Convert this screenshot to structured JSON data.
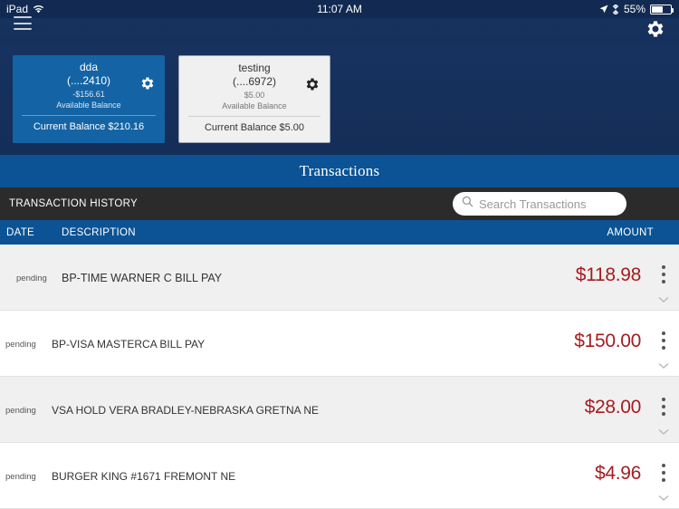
{
  "statusbar": {
    "device": "iPad",
    "wifi_icon": "wifi-icon",
    "time": "11:07 AM",
    "location_icon": "location-arrow-icon",
    "bluetooth_icon": "bluetooth-icon",
    "battery_percent": "55%",
    "battery_icon": "battery-icon"
  },
  "header": {
    "menu_icon": "hamburger-menu-icon",
    "settings_icon": "gear-icon"
  },
  "accounts": [
    {
      "name": "dda",
      "mask": "(....2410)",
      "available_amount": "-$156.61",
      "available_label": "Available Balance",
      "current_balance": "Current Balance $210.16",
      "settings_icon": "gear-icon",
      "selected": true
    },
    {
      "name": "testing",
      "mask": "(....6972)",
      "available_amount": "$5.00",
      "available_label": "Available Balance",
      "current_balance": "Current Balance $5.00",
      "settings_icon": "gear-icon",
      "selected": false
    }
  ],
  "section": {
    "title": "Transactions",
    "history_label": "TRANSACTION HISTORY"
  },
  "search": {
    "placeholder": "Search Transactions",
    "value": "",
    "icon": "search-icon"
  },
  "table": {
    "columns": {
      "date": "DATE",
      "description": "DESCRIPTION",
      "amount": "AMOUNT"
    },
    "rows": [
      {
        "date": "pending",
        "description": "BP-TIME WARNER C BILL PAY",
        "amount": "$118.98",
        "menu_icon": "kebab-menu-icon",
        "expand_icon": "chevron-down-icon"
      },
      {
        "date": "pending",
        "description": "BP-VISA MASTERCA BILL PAY",
        "amount": "$150.00",
        "menu_icon": "kebab-menu-icon",
        "expand_icon": "chevron-down-icon"
      },
      {
        "date": "pending",
        "description": "VSA HOLD VERA BRADLEY-NEBRASKA GRETNA NE",
        "amount": "$28.00",
        "menu_icon": "kebab-menu-icon",
        "expand_icon": "chevron-down-icon"
      },
      {
        "date": "pending",
        "description": "BURGER KING #1671 FREMONT NE",
        "amount": "$4.96",
        "menu_icon": "kebab-menu-icon",
        "expand_icon": "chevron-down-icon"
      }
    ]
  },
  "colors": {
    "navy": "#16325e",
    "blue": "#0b5394",
    "card_selected": "#1464a5",
    "charcoal": "#2b2b2b",
    "amount_red": "#a51c20",
    "row_alt": "#f0f0f0"
  }
}
